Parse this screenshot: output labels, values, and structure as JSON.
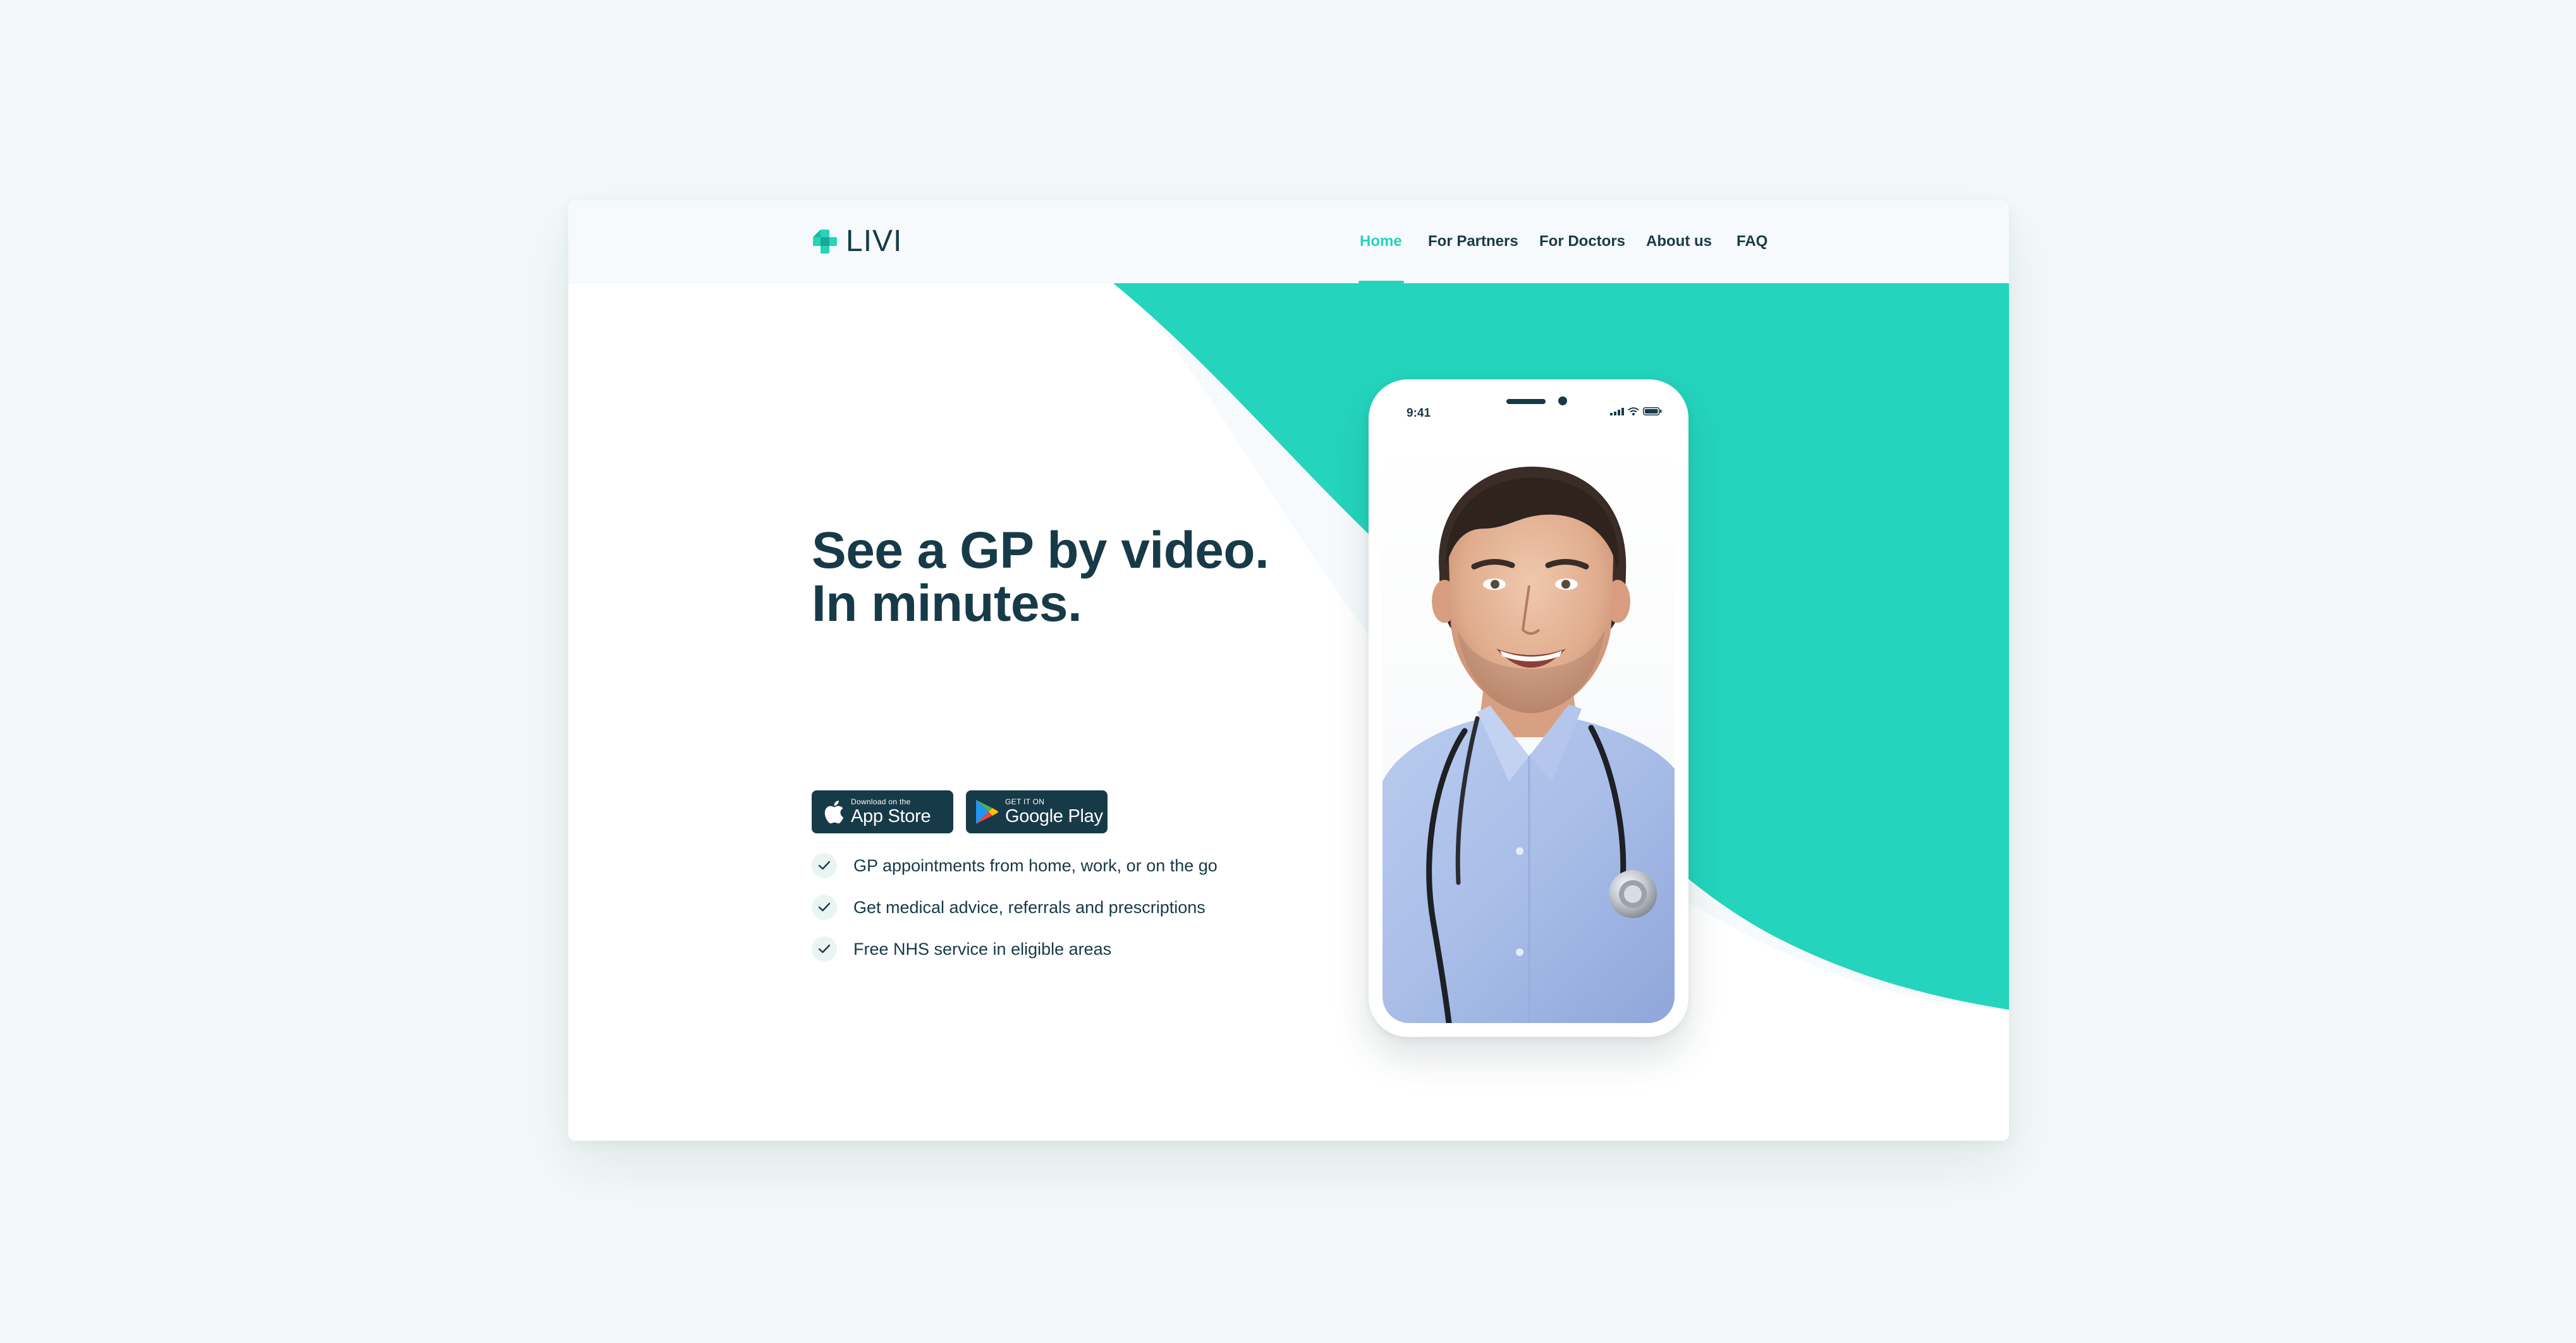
{
  "brand": {
    "name": "LIVI",
    "accent_color": "#24d4bd",
    "text_color": "#173a48",
    "logo_icon": "medical-cross-icon"
  },
  "nav": {
    "items": [
      {
        "label": "Home",
        "active": true
      },
      {
        "label": "For Partners",
        "active": false
      },
      {
        "label": "For Doctors",
        "active": false
      },
      {
        "label": "About us",
        "active": false
      },
      {
        "label": "FAQ",
        "active": false
      }
    ]
  },
  "hero": {
    "title_line1": "See a GP by video.",
    "title_line2": "In minutes.",
    "features": [
      {
        "text": "GP appointments from home, work, or on the go",
        "icon": "check-icon"
      },
      {
        "text": "Get medical advice, referrals and prescriptions",
        "icon": "check-icon"
      },
      {
        "text": "Free NHS service in eligible areas",
        "icon": "check-icon"
      }
    ]
  },
  "badges": {
    "app_store": {
      "small": "Download on the",
      "big": "App Store",
      "icon": "apple-icon"
    },
    "google_play": {
      "small": "GET IT ON",
      "big": "Google Play",
      "icon": "play-icon"
    }
  },
  "phone": {
    "time": "9:41",
    "status_icons": [
      "signal-icon",
      "wifi-icon",
      "battery-icon"
    ]
  }
}
